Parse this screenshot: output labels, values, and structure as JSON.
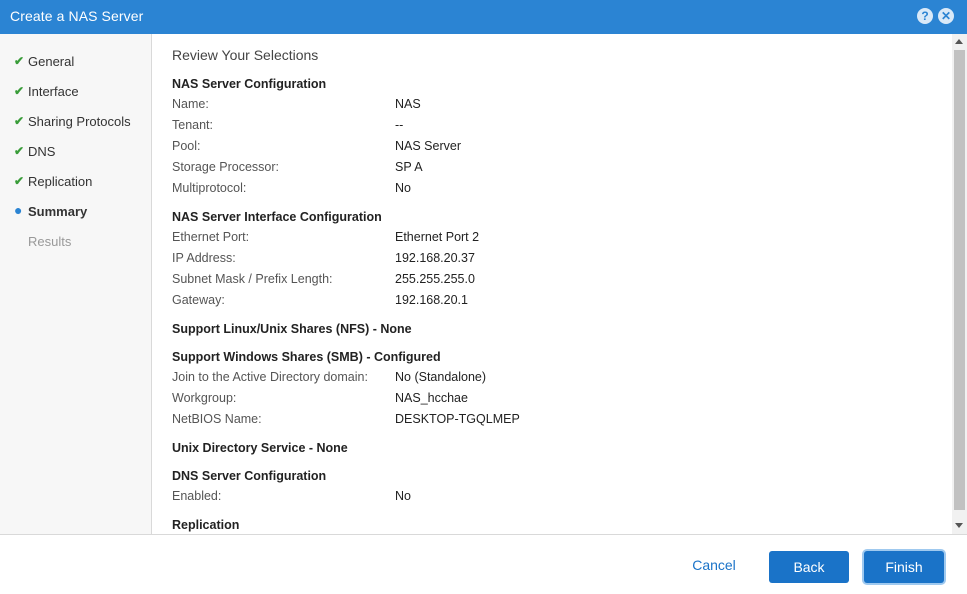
{
  "window": {
    "title": "Create a NAS Server",
    "help_glyph": "?",
    "close_glyph": "✕"
  },
  "steps": [
    {
      "label": "General",
      "status": "done"
    },
    {
      "label": "Interface",
      "status": "done"
    },
    {
      "label": "Sharing Protocols",
      "status": "done"
    },
    {
      "label": "DNS",
      "status": "done"
    },
    {
      "label": "Replication",
      "status": "done"
    },
    {
      "label": "Summary",
      "status": "active"
    },
    {
      "label": "Results",
      "status": "disabled"
    }
  ],
  "main": {
    "heading": "Review Your Selections",
    "nas_config": {
      "title": "NAS Server Configuration",
      "rows": [
        {
          "k": "Name:",
          "v": "NAS"
        },
        {
          "k": "Tenant:",
          "v": "--"
        },
        {
          "k": "Pool:",
          "v": "NAS Server"
        },
        {
          "k": "Storage Processor:",
          "v": "SP A"
        },
        {
          "k": "Multiprotocol:",
          "v": "No"
        }
      ]
    },
    "interface_config": {
      "title": "NAS Server Interface Configuration",
      "rows": [
        {
          "k": "Ethernet Port:",
          "v": "Ethernet Port 2"
        },
        {
          "k": "IP Address:",
          "v": "192.168.20.37"
        },
        {
          "k": "Subnet Mask / Prefix Length:",
          "v": "255.255.255.0"
        },
        {
          "k": "Gateway:",
          "v": "192.168.20.1"
        }
      ]
    },
    "nfs": {
      "title": "Support Linux/Unix Shares (NFS) - None"
    },
    "smb": {
      "title": "Support Windows Shares (SMB) - Configured",
      "rows": [
        {
          "k": "Join to the Active Directory domain:",
          "v": "No (Standalone)"
        },
        {
          "k": "Workgroup:",
          "v": "NAS_hcchae"
        },
        {
          "k": "NetBIOS Name:",
          "v": "DESKTOP-TGQLMEP"
        }
      ]
    },
    "unix_dir": {
      "title": "Unix Directory Service - None"
    },
    "dns": {
      "title": "DNS Server Configuration",
      "rows": [
        {
          "k": "Enabled:",
          "v": "No"
        }
      ]
    },
    "replication": {
      "title": "Replication"
    }
  },
  "footer": {
    "cancel_label": "Cancel",
    "back_label": "Back",
    "finish_label": "Finish"
  },
  "colors": {
    "titlebar": "#2b84d3",
    "primary_button": "#1a73c8",
    "check": "#3a9d3a"
  }
}
